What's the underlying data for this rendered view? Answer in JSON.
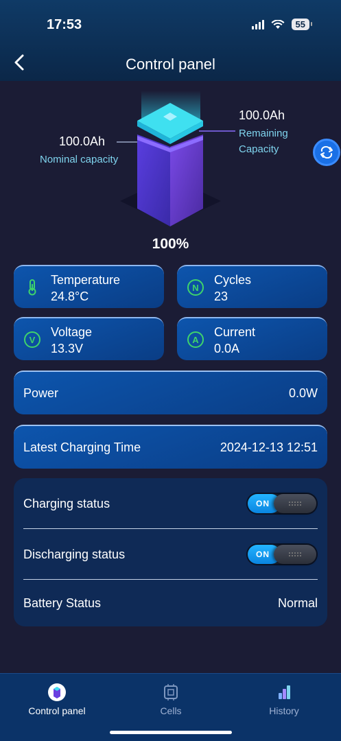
{
  "status_bar": {
    "time": "17:53",
    "battery": "55"
  },
  "header": {
    "title": "Control panel"
  },
  "hero": {
    "nominal_value": "100.0Ah",
    "nominal_label": "Nominal capacity",
    "remaining_value": "100.0Ah",
    "remaining_label_1": "Remaining",
    "remaining_label_2": "Capacity",
    "percent": "100%"
  },
  "stats": {
    "temperature": {
      "label": "Temperature",
      "value": "24.8°C",
      "icon": "thermometer-icon"
    },
    "cycles": {
      "label": "Cycles",
      "value": "23",
      "icon": "n-circle-icon"
    },
    "voltage": {
      "label": "Voltage",
      "value": "13.3V",
      "icon": "v-circle-icon"
    },
    "current": {
      "label": "Current",
      "value": "0.0A",
      "icon": "a-circle-icon"
    }
  },
  "power": {
    "label": "Power",
    "value": "0.0W"
  },
  "charging_time": {
    "label": "Latest Charging Time",
    "value": "2024-12-13 12:51"
  },
  "statuses": {
    "charging": {
      "label": "Charging status",
      "toggle": "ON"
    },
    "discharging": {
      "label": "Discharging status",
      "toggle": "ON"
    },
    "battery": {
      "label": "Battery Status",
      "value": "Normal"
    }
  },
  "nav": {
    "items": [
      {
        "label": "Control panel",
        "active": true
      },
      {
        "label": "Cells",
        "active": false
      },
      {
        "label": "History",
        "active": false
      }
    ]
  },
  "colors": {
    "accent": "#1a70e6",
    "green_icon": "#3fd46b",
    "cyan_label": "#7fd4ee"
  }
}
